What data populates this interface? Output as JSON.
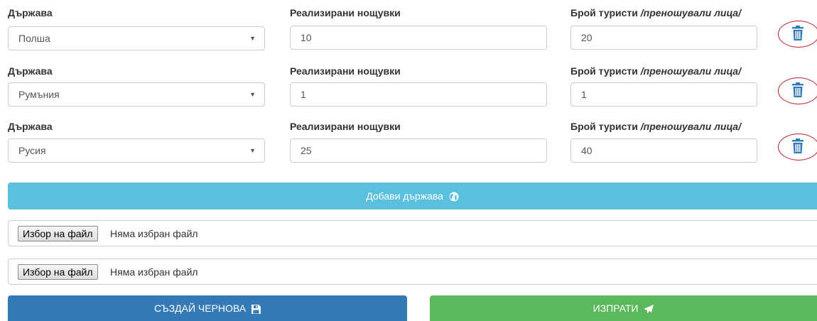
{
  "rows": [
    {
      "country_label": "Държава",
      "country_value": "Полша",
      "nights_label": "Реализирани нощувки",
      "nights_value": "10",
      "tourists_label": "Брой туристи",
      "tourists_label_italic": "/преношували лица/",
      "tourists_value": "20"
    },
    {
      "country_label": "Държава",
      "country_value": "Румъния",
      "nights_label": "Реализирани нощувки",
      "nights_value": "1",
      "tourists_label": "Брой туристи",
      "tourists_label_italic": "/преношували лица/",
      "tourists_value": "1"
    },
    {
      "country_label": "Държава",
      "country_value": "Русия",
      "nights_label": "Реализирани нощувки",
      "nights_value": "25",
      "tourists_label": "Брой туристи",
      "tourists_label_italic": "/преношували лица/",
      "tourists_value": "40"
    }
  ],
  "icons": {
    "delete": "trash-icon",
    "add": "globe-icon",
    "draft": "save-icon",
    "send": "paper-plane-icon",
    "select": "caret-down-icon"
  },
  "add_country_label": "Добави държава",
  "files": [
    {
      "button_label": "Избор на файл",
      "status": "Няма избран файл"
    },
    {
      "button_label": "Избор на файл",
      "status": "Няма избран файл"
    }
  ],
  "draft_button_label": "СЪЗДАЙ ЧЕРНОВА",
  "send_button_label": "ИЗПРАТИ",
  "colors": {
    "info": "#5bc0de",
    "primary": "#337ab7",
    "success": "#5cb85c",
    "delete_icon": "#337ab7",
    "delete_highlight": "#b5212a"
  }
}
